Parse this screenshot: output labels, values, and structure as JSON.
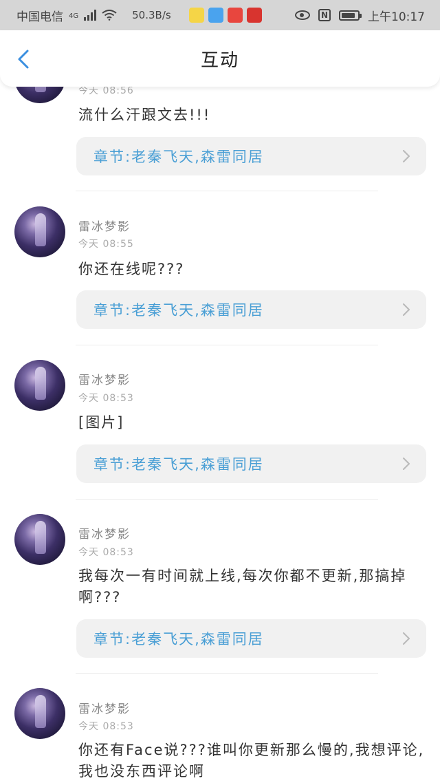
{
  "status_bar": {
    "carrier": "中国电信",
    "network": "4G",
    "speed": "50.3B/s",
    "time": "上午10:17"
  },
  "header": {
    "title": "互动"
  },
  "colors": {
    "link": "#4a9fd5",
    "chapter_bg": "#f1f1f1",
    "status_bg": "#d6d6d6"
  },
  "messages": [
    {
      "username": "",
      "time": "今天 08:56",
      "text": "流什么汗跟文去!!!",
      "chapter": "章节:老秦飞天,森雷同居"
    },
    {
      "username": "雷冰梦影",
      "time": "今天 08:55",
      "text": "你还在线呢???",
      "chapter": "章节:老秦飞天,森雷同居"
    },
    {
      "username": "雷冰梦影",
      "time": "今天 08:53",
      "text": "[图片]",
      "chapter": "章节:老秦飞天,森雷同居"
    },
    {
      "username": "雷冰梦影",
      "time": "今天 08:53",
      "text": "我每次一有时间就上线,每次你都不更新,那搞掉啊???",
      "chapter": "章节:老秦飞天,森雷同居"
    },
    {
      "username": "雷冰梦影",
      "time": "今天 08:53",
      "text": "你还有Face说???谁叫你更新那么慢的,我想评论,我也没东西评论啊",
      "chapter": ""
    }
  ]
}
